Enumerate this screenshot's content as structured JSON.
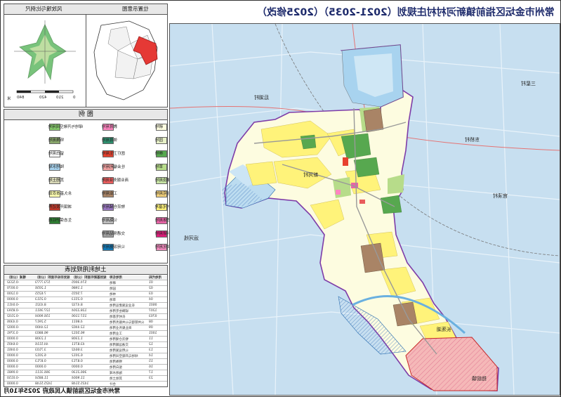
{
  "title": "常州市金坛区指前镇新河村村庄规划（2021-2035）（2025修改）",
  "sheet_name": "土地利用规划图",
  "locator": {
    "heading_left": "风玫瑰与比例尺",
    "heading_right": "位置示意图",
    "scale_ticks": [
      "0",
      "210",
      "420",
      "840"
    ],
    "scale_unit": "米"
  },
  "legend": {
    "title": "图  例",
    "items": [
      {
        "label": "耕地",
        "color": "#fdfde0"
      },
      {
        "label": "园地",
        "color": "#e8f2c8"
      },
      {
        "label": "林地",
        "color": "#57a84f"
      },
      {
        "label": "草地",
        "color": "#b7dc8a"
      },
      {
        "label": "农业设施建设用地",
        "color": "#c9e6a5"
      },
      {
        "label": "城镇住宅用地",
        "color": "#f4d27c"
      },
      {
        "label": "农村宅基地",
        "color": "#fff37a"
      },
      {
        "label": "机关团体用地",
        "color": "#e864a6"
      },
      {
        "label": "科研用地",
        "color": "#e01f7c"
      },
      {
        "label": "文化用地",
        "color": "#f08bbd"
      },
      {
        "label": "教育用地",
        "color": "#ff85c0"
      },
      {
        "label": "体育用地",
        "color": "#2e8f6e"
      },
      {
        "label": "医疗卫生用地",
        "color": "#e8412e"
      },
      {
        "label": "社会福利用地",
        "color": "#f4a3a3"
      },
      {
        "label": "商业服务业用地",
        "color": "#e95c5c"
      },
      {
        "label": "工业用地",
        "color": "#a98466"
      },
      {
        "label": "物流仓储用地",
        "color": "#9b78c2"
      },
      {
        "label": "公路用地",
        "color": "#bfbfbf"
      },
      {
        "label": "交通场站用地",
        "color": "#a0a0a0"
      },
      {
        "label": "公用设施用地",
        "color": "#137ab8"
      },
      {
        "label": "绿地与开敞空间用地",
        "color": "#85c96b"
      },
      {
        "label": "特殊用地",
        "color": "#8aa86c"
      },
      {
        "label": "留白用地",
        "color": "#ffffff"
      },
      {
        "label": "陆地水域",
        "color": "#a8d3ef"
      },
      {
        "label": "其他土地",
        "color": "#d9d9b8"
      },
      {
        "label": "永久基本农田",
        "color": "#ffffb0"
      },
      {
        "label": "城镇开发边界",
        "color": "#c0392b"
      },
      {
        "label": "生态保护红线",
        "color": "#2e7d32"
      }
    ]
  },
  "table": {
    "title": "土地利用规划表",
    "headers": [
      "用地代码",
      "用地名称",
      "规划基期年面积（公顷）",
      "规划目标年面积（公顷）",
      "增减（公顷）"
    ],
    "rows": [
      [
        "01",
        "耕地",
        "574.3005",
        "573.7773",
        "-0.5232"
      ],
      [
        "02",
        "园地",
        "1.1986",
        "1.2056",
        "0.0070"
      ],
      [
        "03",
        "林地",
        "7.5055",
        "7.6255",
        "0.1200"
      ],
      [
        "04",
        "草地",
        "0.2513",
        "0.2513",
        "0.0000"
      ],
      [
        "0601",
        "农业设施建设用地",
        "8.4732",
        "8.4321",
        "-0.0411"
      ],
      [
        "1207",
        "城镇住宅用地",
        "128.2204",
        "127.3611",
        "-0.8593"
      ],
      [
        "0703",
        "农村宅基地",
        "157.1106",
        "156.9004",
        "-0.2102"
      ],
      [
        "08",
        "公共管理与公共服务用地",
        "4.8611",
        "5.2917",
        "0.4306"
      ],
      [
        "09",
        "商业服务业用地",
        "12.4402",
        "12.4400",
        "-0.0002"
      ],
      [
        "1001",
        "工业用地",
        "96.5012",
        "96.8803",
        "0.3791"
      ],
      [
        "11",
        "物流仓储用地",
        "1.2308",
        "1.2308",
        "0.0000"
      ],
      [
        "12",
        "交通运输用地",
        "43.8711",
        "44.5116",
        "0.6405"
      ],
      [
        "13",
        "公用设施用地",
        "3.6642",
        "3.7103",
        "0.0461"
      ],
      [
        "14",
        "绿地与开敞空间用地",
        "6.2012",
        "6.2012",
        "0.0000"
      ],
      [
        "15",
        "特殊用地",
        "0.8713",
        "0.8713",
        "0.0000"
      ],
      [
        "16",
        "留白用地",
        "0.0000",
        "0.0000",
        "0.0000"
      ],
      [
        "17",
        "陆地水域",
        "366.2130",
        "366.3111",
        "0.0981"
      ],
      [
        "23",
        "其他土地",
        "11.9004",
        "11.8854",
        "-0.0150"
      ],
      [
        "",
        "合计",
        "1425.5148",
        "1425.5148",
        "0.0000"
      ]
    ]
  },
  "footer": "常州市金坛区指前镇人民政府  2025年10月",
  "map_labels": [
    {
      "name": "label-xinhe",
      "text": "新河村"
    },
    {
      "name": "label-changdang",
      "text": "长荡湖"
    },
    {
      "name": "label-zhiqian",
      "text": "指前镇"
    },
    {
      "name": "label-huluncun",
      "text": "后湖村"
    },
    {
      "name": "label-dongqiao",
      "text": "东桥村"
    },
    {
      "name": "label-sanxing",
      "text": "三星村"
    },
    {
      "name": "label-guancun",
      "text": "官渎村"
    },
    {
      "name": "label-yunfeng",
      "text": "运河线"
    }
  ]
}
